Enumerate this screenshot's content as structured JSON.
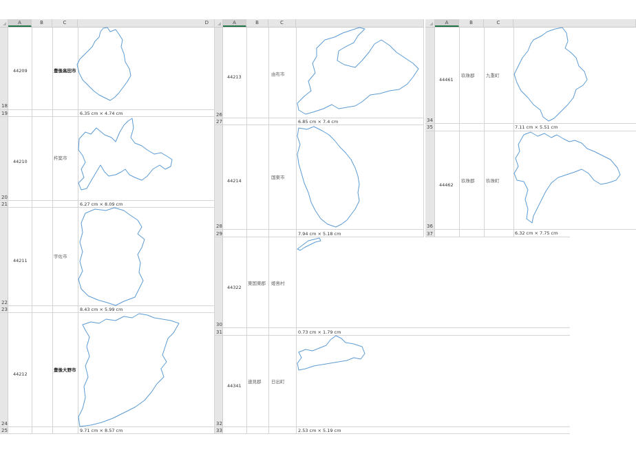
{
  "panel1": {
    "columns": [
      "A",
      "B",
      "C",
      "D"
    ],
    "rows": [
      "18",
      "19",
      "20",
      "21",
      "22",
      "23",
      "24",
      "25"
    ],
    "entries": [
      {
        "code": "44209",
        "name": "豊後高田市",
        "size": "6.35 cm × 4.74 cm"
      },
      {
        "code": "44210",
        "name": "杵築市",
        "size": "6.27 cm × 8.09 cm"
      },
      {
        "code": "44211",
        "name": "宇佐市",
        "size": "8.43 cm × 5.99 cm"
      },
      {
        "code": "44212",
        "name": "豊後大野市",
        "size": "9.71 cm × 8.57 cm"
      }
    ]
  },
  "panel2": {
    "columns": [
      "A",
      "B",
      "C"
    ],
    "rows": [
      "26",
      "27",
      "28",
      "29",
      "30",
      "31",
      "32",
      "33"
    ],
    "entries": [
      {
        "code": "44213",
        "district": "",
        "name": "由布市",
        "size": "6.85 cm × 7.4 cm"
      },
      {
        "code": "44214",
        "district": "",
        "name": "国東市",
        "size": "7.94 cm × 5.18 cm"
      },
      {
        "code": "44322",
        "district": "東国東郡",
        "name": "姫島村",
        "size": "0.73 cm × 1.79 cm"
      },
      {
        "code": "44341",
        "district": "速見郡",
        "name": "日出町",
        "size": "2.53 cm × 5.19 cm"
      }
    ]
  },
  "panel3": {
    "columns": [
      "A",
      "B",
      "C"
    ],
    "rows": [
      "34",
      "35",
      "36",
      "37"
    ],
    "entries": [
      {
        "code": "44461",
        "district": "玖珠郡",
        "name": "九重町",
        "size": "7.11 cm × 5.51 cm"
      },
      {
        "code": "44462",
        "district": "玖珠郡",
        "name": "玖珠町",
        "size": "6.32 cm × 7.75 cm"
      }
    ]
  },
  "icons": {
    "select_all": "select-all-triangle-icon"
  },
  "colors": {
    "outline": "#5b9bd5",
    "header_bg": "#e6e6e6",
    "selected_col": "#217346"
  }
}
